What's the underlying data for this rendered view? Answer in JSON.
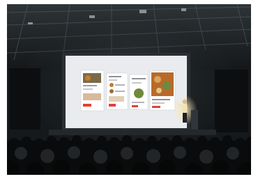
{
  "photo": {
    "subject": "presentation-stage",
    "colors": {
      "hall": "#15191b",
      "ceiling": "#23282b",
      "screen": "#e9ebee",
      "frame": "#2a2f33",
      "accent": "#e0413a",
      "food": "#c77a2c",
      "stage_light": "#f1e3b5"
    }
  }
}
